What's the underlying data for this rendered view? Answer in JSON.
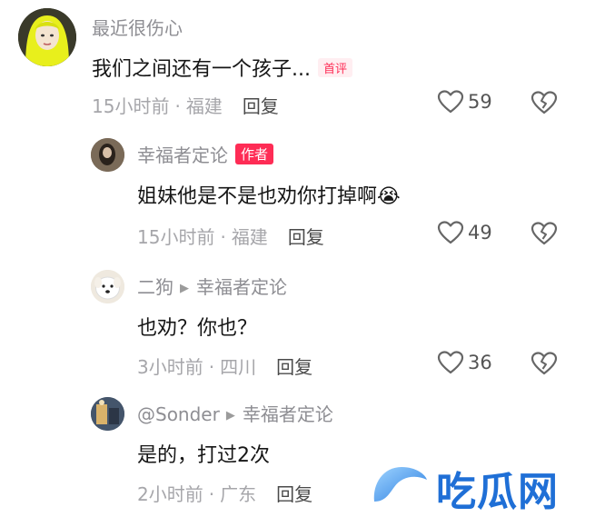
{
  "comments": [
    {
      "username": "最近很伤心",
      "text": "我们之间还有一个孩子...",
      "badge": "首评",
      "time": "15小时前",
      "location": "福建",
      "reply_label": "回复",
      "likes": "59"
    },
    {
      "username": "幸福者定论",
      "badge": "作者",
      "text": "姐妹他是不是也劝你打掉啊",
      "emoji": "😭",
      "time": "15小时前",
      "location": "福建",
      "reply_label": "回复",
      "likes": "49"
    },
    {
      "username": "二狗",
      "reply_to": "幸福者定论",
      "text": "也劝？你也？",
      "time": "3小时前",
      "location": "四川",
      "reply_label": "回复",
      "likes": "36"
    },
    {
      "username": "@Sonder",
      "reply_to": "幸福者定论",
      "text": "是的，打过2次",
      "time": "2小时前",
      "location": "广东",
      "reply_label": "回复"
    }
  ],
  "meta_separator": "·",
  "reply_arrow": "▶",
  "watermark": {
    "text": "吃瓜网"
  },
  "icons": {
    "like": "heart-outline-icon",
    "dislike": "broken-heart-icon"
  },
  "colors": {
    "accent": "#fe2c55",
    "watermark": "#1f6fd6"
  }
}
